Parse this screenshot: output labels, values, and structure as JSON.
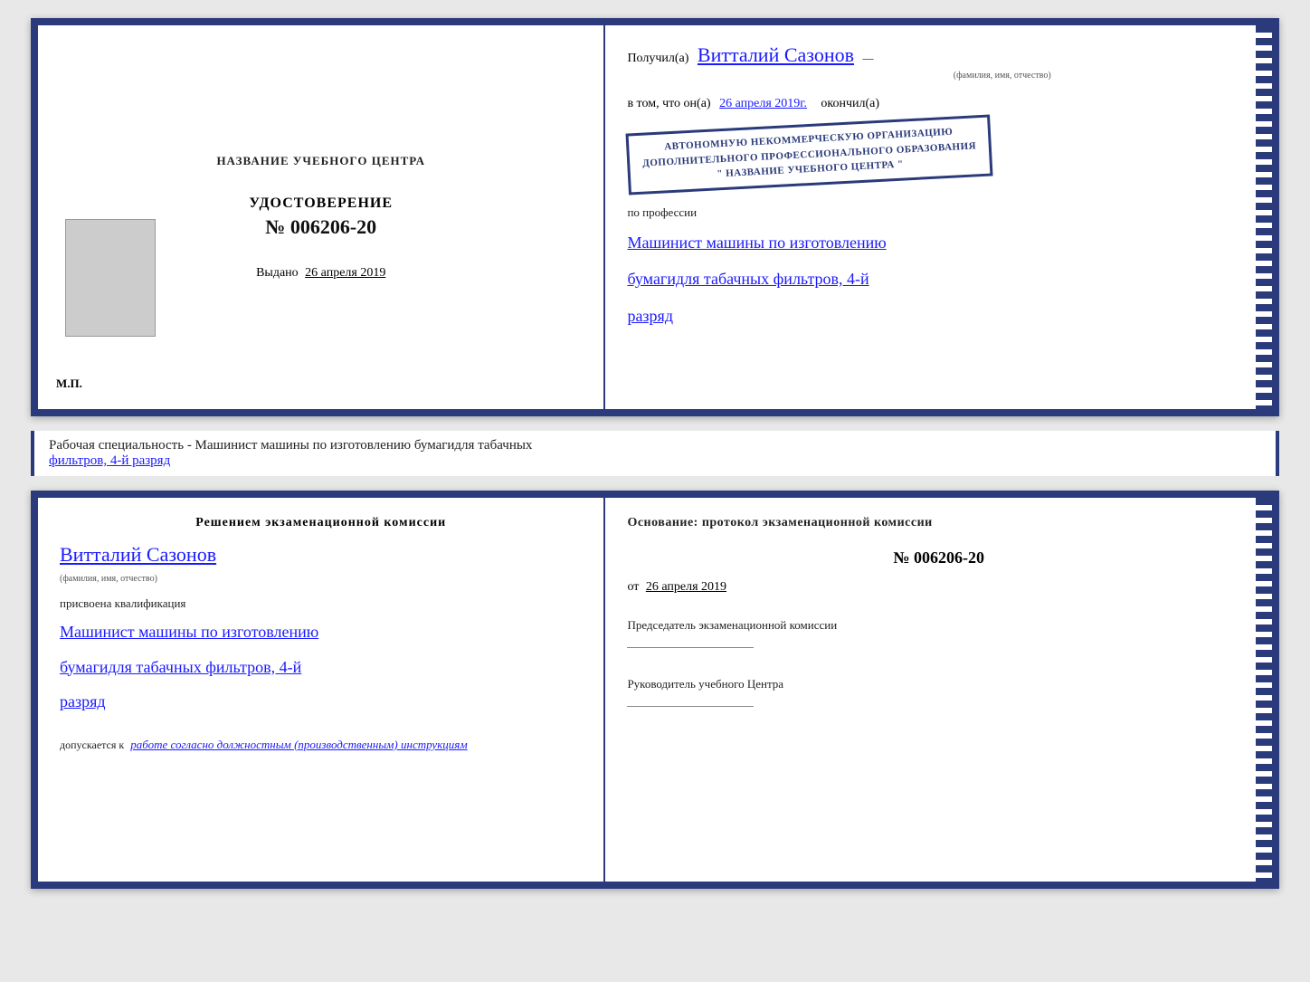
{
  "top_cert": {
    "left": {
      "training_center_label": "НАЗВАНИЕ УЧЕБНОГО ЦЕНТРА",
      "cert_title": "УДОСТОВЕРЕНИЕ",
      "cert_number": "№ 006206-20",
      "issued_label": "Выдано",
      "issued_date": "26 апреля 2019",
      "mp_label": "М.П."
    },
    "right": {
      "received_prefix": "Получил(а)",
      "name": "Витталий Сазонов",
      "name_subtitle": "(фамилия, имя, отчество)",
      "in_that_prefix": "в том, что он(а)",
      "date_handwritten": "26 апреля 2019г.",
      "finished_label": "окончил(а)",
      "stamp_line1": "АВТОНОМНУЮ НЕКОММЕРЧЕСКУЮ ОРГАНИЗАЦИЮ",
      "stamp_line2": "ДОПОЛНИТЕЛЬНОГО ПРОФЕССИОНАЛЬНОГО ОБРАЗОВАНИЯ",
      "stamp_line3": "\" НАЗВАНИЕ УЧЕБНОГО ЦЕНТРА \"",
      "profession_prefix": "по профессии",
      "profession_line1": "Машинист машины по изготовлению",
      "profession_line2": "бумагидля табачных фильтров, 4-й",
      "profession_line3": "разряд"
    }
  },
  "info_strip": {
    "label": "Рабочая специальность - Машинист машины по изготовлению бумагидля табачных",
    "label2": "фильтров, 4-й разряд"
  },
  "bottom_cert": {
    "left": {
      "decision_title": "Решением  экзаменационной  комиссии",
      "name": "Витталий Сазонов",
      "name_subtitle": "(фамилия, имя, отчество)",
      "assigned_label": "присвоена квалификация",
      "profession_line1": "Машинист машины по изготовлению",
      "profession_line2": "бумагидля табачных фильтров, 4-й",
      "profession_line3": "разряд",
      "allowed_prefix": "допускается к",
      "allowed_text": "работе согласно должностным (производственным) инструкциям"
    },
    "right": {
      "basis_label": "Основание: протокол экзаменационной  комиссии",
      "protocol_number": "№  006206-20",
      "date_prefix": "от",
      "date_value": "26 апреля 2019",
      "chairman_label": "Председатель экзаменационной комиссии",
      "head_label": "Руководитель учебного Центра"
    }
  }
}
